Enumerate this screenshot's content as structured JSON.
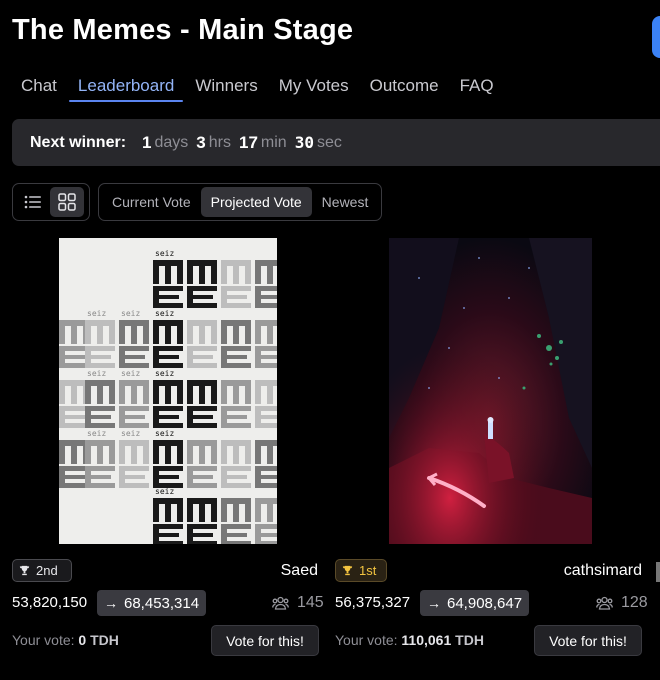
{
  "page": {
    "title": "The Memes - Main Stage"
  },
  "tabs": [
    "Chat",
    "Leaderboard",
    "Winners",
    "My Votes",
    "Outcome",
    "FAQ"
  ],
  "active_tab": "Leaderboard",
  "countdown": {
    "label": "Next winner:",
    "days": "1",
    "days_unit": "days",
    "hrs": "3",
    "hrs_unit": "hrs",
    "min": "17",
    "min_unit": "min",
    "sec": "30",
    "sec_unit": "sec"
  },
  "view_toggle": {
    "active": "grid",
    "icons": [
      "list-icon",
      "grid-icon"
    ]
  },
  "sort_tabs": [
    "Current Vote",
    "Projected Vote",
    "Newest"
  ],
  "active_sort": "Projected Vote",
  "cards": [
    {
      "rank": "2nd",
      "author": "Saed",
      "current_votes": "53,820,150",
      "projected_votes": "68,453,314",
      "voters": "145",
      "your_vote_label": "Your vote:",
      "your_vote_value": "0",
      "your_vote_unit": "TDH",
      "vote_button": "Vote for this!",
      "art_text": "seiz"
    },
    {
      "rank": "1st",
      "author": "cathsimard",
      "current_votes": "56,375,327",
      "projected_votes": "64,908,647",
      "voters": "128",
      "your_vote_label": "Your vote:",
      "your_vote_value": "110,061",
      "your_vote_unit": "TDH",
      "vote_button": "Vote for this!"
    }
  ],
  "colors": {
    "accent": "#5b85f0",
    "gold": "#f3c440",
    "panel": "#28282c"
  }
}
